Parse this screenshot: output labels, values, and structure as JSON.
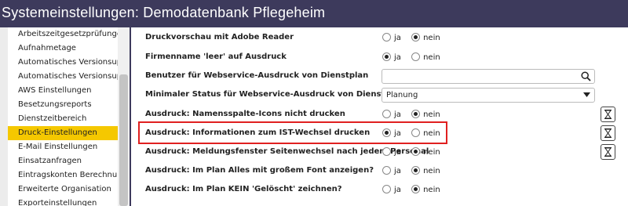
{
  "window": {
    "title": "Systemeinstellungen: Demodatenbank Pflegeheim"
  },
  "sidebar": {
    "items": [
      {
        "label": "Arbeitszeitgesetzprüfungen"
      },
      {
        "label": "Aufnahmetage"
      },
      {
        "label": "Automatisches Versionsupda"
      },
      {
        "label": "Automatisches Versionsupda"
      },
      {
        "label": "AWS Einstellungen"
      },
      {
        "label": "Besetzungsreports"
      },
      {
        "label": "Dienstzeitbereich"
      },
      {
        "label": "Druck-Einstellungen",
        "active": true
      },
      {
        "label": "E-Mail Einstellungen"
      },
      {
        "label": "Einsatzanfragen"
      },
      {
        "label": "Eintragskonten Berechnung"
      },
      {
        "label": "Erweiterte Organisation"
      },
      {
        "label": "Exporteinstellungen"
      }
    ]
  },
  "options": {
    "ja": "ja",
    "nein": "nein"
  },
  "settings": [
    {
      "label": "Druckvorschau mit Adobe Reader",
      "type": "radio",
      "value": "nein"
    },
    {
      "label": "Firmenname 'leer' auf Ausdruck",
      "type": "radio",
      "value": "ja"
    },
    {
      "label": "Benutzer für Webservice-Ausdruck von Dienstplan",
      "type": "search",
      "value": ""
    },
    {
      "label": "Minimaler Status für Webservice-Ausdruck von Dienstplan",
      "type": "select",
      "value": "Planung"
    },
    {
      "label": "Ausdruck: Namensspalte-Icons nicht drucken",
      "type": "radio",
      "value": "nein"
    },
    {
      "label": "Ausdruck: Informationen zum IST-Wechsel drucken",
      "type": "radio",
      "value": "ja",
      "highlighted": true
    },
    {
      "label": "Ausdruck: Meldungsfenster Seitenwechsel nach jedem Personal",
      "type": "radio",
      "value": "nein"
    },
    {
      "label": "Ausdruck: Im Plan Alles mit großem Font anzeigen?",
      "type": "radio",
      "value": "nein"
    },
    {
      "label": "Ausdruck: Im Plan KEIN 'Gelöscht' zeichnen?",
      "type": "radio",
      "value": "nein"
    }
  ],
  "icons": {
    "search": "search-icon",
    "dropdown": "chevron-down-icon",
    "hourglass": "hourglass-icon"
  },
  "colors": {
    "titlebar": "#3d3a5c",
    "active_item": "#f5c800",
    "highlight": "#e02020"
  }
}
